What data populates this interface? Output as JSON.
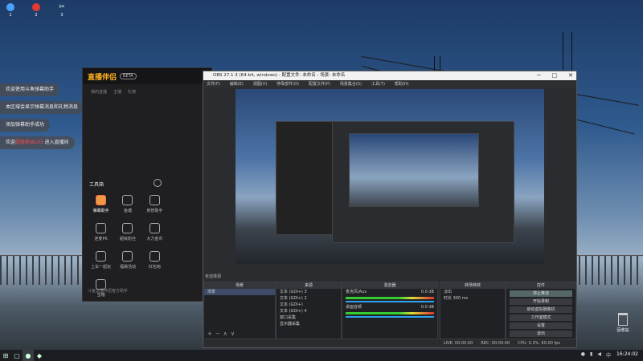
{
  "desktop_icons": [
    {
      "name": "search-tool-icon",
      "label": "1"
    },
    {
      "name": "red-app-icon",
      "label": "2"
    },
    {
      "name": "scissors-icon",
      "label": "3"
    }
  ],
  "notifications": [
    {
      "text": "欢迎使用斗鱼弹幕助手"
    },
    {
      "text": "本区域会显示弹幕消息和礼物消息"
    },
    {
      "text": "添加弹幕助手成功"
    },
    {
      "prefix": "欢迎",
      "highlight": "超级粉丝LV3",
      "suffix": " 进入直播间",
      "extra": "赵子龙"
    }
  ],
  "chat_app": {
    "logo": "直播伴侣",
    "badge": "BETA",
    "tabs": [
      "我的直播",
      "主播",
      "礼物"
    ],
    "tools_heading": "工具箱",
    "tools": [
      {
        "label": "弹幕助手",
        "active": true
      },
      {
        "label": "鱼塘",
        "active": false
      },
      {
        "label": "房管助手",
        "active": false
      },
      {
        "label": "连麦PK",
        "active": false
      },
      {
        "label": "超级粉丝",
        "active": false
      },
      {
        "label": "大力金币",
        "active": false
      },
      {
        "label": "上车一起玩",
        "active": false
      },
      {
        "label": "福袋活动",
        "active": false
      },
      {
        "label": "红包雨",
        "active": false
      },
      {
        "label": "宝箱",
        "active": false
      },
      {
        "label": "",
        "active": false
      },
      {
        "label": "",
        "active": false
      }
    ],
    "footer": "斗鱼直播伴侣官方助手"
  },
  "obs": {
    "title": "OBS 27.1.3 (64-bit, windows) - 配置文件: 未命名 - 场景: 未命名",
    "menu": [
      "文件(F)",
      "编辑(E)",
      "视图(V)",
      "停靠部件(D)",
      "配置文件(P)",
      "场景集合(S)",
      "工具(T)",
      "帮助(H)"
    ],
    "window_controls": [
      "─",
      "□",
      "✕"
    ],
    "no_source": "未选择源",
    "docks": {
      "scenes": {
        "title": "场景",
        "items": [
          "场景"
        ]
      },
      "sources": {
        "title": "来源",
        "items": [
          "文本 (GDI+) 3",
          "文本 (GDI+) 2",
          "文本 (GDI+)",
          "文本 (GDI+) 4",
          "窗口采集",
          "显示器采集"
        ]
      },
      "mixer": {
        "title": "混音器",
        "tracks": [
          {
            "name": "麦克风/Aux",
            "db": "0.0 dB"
          },
          {
            "name": "桌面音频",
            "db": "0.0 dB"
          }
        ]
      },
      "transitions": {
        "title": "转场特效",
        "type": "淡出",
        "duration_label": "时长",
        "duration": "300 ms"
      },
      "controls": {
        "title": "控件",
        "buttons": [
          "停止推流",
          "开始录制",
          "启动虚拟摄像机",
          "工作室模式",
          "设置",
          "退出"
        ]
      }
    },
    "status": {
      "live": "LIVE: 00:00:00",
      "rec": "REC: 00:00:00",
      "cpu": "CPU: 0.3%, 60.00 fps"
    }
  },
  "taskbar": {
    "start_icon": "windows-start-icon",
    "clock": "16:24:02"
  },
  "recycle_bin": {
    "label": "回收站"
  },
  "colors": {
    "accent": "#2ea3f2",
    "brand": "#ffb020",
    "alert": "#ff4b4b"
  }
}
